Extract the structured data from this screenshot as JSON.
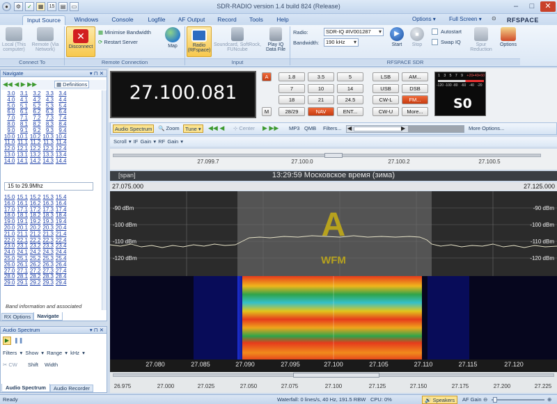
{
  "window": {
    "title": "SDR-RADIO version 1.4 build 824 (Release)",
    "controls": {
      "minimize": "–",
      "maximize": "□",
      "close": "✕"
    },
    "quick_access": [
      "⚙",
      "✓",
      "15"
    ]
  },
  "tabs": [
    "Input Source",
    "Windows",
    "Console",
    "Logfile",
    "AF Output",
    "Record",
    "Tools",
    "Help"
  ],
  "top_right": {
    "options": "Options",
    "full_screen": "Full Screen",
    "logo": "RFSPACE"
  },
  "ribbon": {
    "connect_to": {
      "local": "Local (This computer)",
      "remote": "Remote (Via Network)",
      "label": "Connect To"
    },
    "remote_connection": {
      "disconnect": "Disconnect",
      "minimise": "Minimise Bandwidth",
      "restart": "Restart Server",
      "map": "Map",
      "label": "Remote Connection"
    },
    "input": {
      "radio": "Radio (RFspace)",
      "soundcard": "Soundcard, SoftRock, FUNcube",
      "playiq": "Play IQ Data File",
      "label": "Input"
    },
    "rfspace": {
      "radio_label": "Radio:",
      "radio_value": "SDR-IQ #IV001287",
      "bandwidth_label": "Bandwidth:",
      "bandwidth_value": "190 kHz",
      "start": "Start",
      "stop": "Stop",
      "autostart": "Autostart",
      "swapiq": "Swap IQ",
      "spur": "Spur Reduction",
      "options": "Options",
      "label": "RFSPACE SDR"
    }
  },
  "navigate": {
    "title": "Navigate",
    "definitions": "Definitions",
    "band_label": "15 to 29.9Mhz",
    "footer": "Band information and associated",
    "tabs": [
      "RX Options",
      "Navigate"
    ],
    "grid1": [
      [
        "3.0",
        "3.1",
        "3.2",
        "3.3",
        "3.4"
      ],
      [
        "4.0",
        "4.1",
        "4.2",
        "4.3",
        "4.4"
      ],
      [
        "5.0",
        "5.1",
        "5.2",
        "5.3",
        "5.4"
      ],
      [
        "6.0",
        "6.1",
        "6.2",
        "6.3",
        "6.4"
      ],
      [
        "7.0",
        "7.1",
        "7.2",
        "7.3",
        "7.4"
      ],
      [
        "8.0",
        "8.1",
        "8.2",
        "8.3",
        "8.4"
      ],
      [
        "9.0",
        "9.1",
        "9.2",
        "9.3",
        "9.4"
      ],
      [
        "10.0",
        "10.1",
        "10.2",
        "10.3",
        "10.4"
      ],
      [
        "11.0",
        "11.1",
        "11.2",
        "11.3",
        "11.4"
      ],
      [
        "12.0",
        "12.1",
        "12.2",
        "12.3",
        "12.4"
      ],
      [
        "13.0",
        "13.1",
        "13.2",
        "13.3",
        "13.4"
      ],
      [
        "14.0",
        "14.1",
        "14.2",
        "14.3",
        "14.4"
      ]
    ],
    "grid2": [
      [
        "15.0",
        "15.1",
        "15.2",
        "15.3",
        "15.4"
      ],
      [
        "16.0",
        "16.1",
        "16.2",
        "16.3",
        "16.4"
      ],
      [
        "17.0",
        "17.1",
        "17.2",
        "17.3",
        "17.4"
      ],
      [
        "18.0",
        "18.1",
        "18.2",
        "18.3",
        "18.4"
      ],
      [
        "19.0",
        "19.1",
        "19.2",
        "19.3",
        "19.4"
      ],
      [
        "20.0",
        "20.1",
        "20.2",
        "20.3",
        "20.4"
      ],
      [
        "21.0",
        "21.1",
        "21.2",
        "21.3",
        "21.4"
      ],
      [
        "22.0",
        "22.1",
        "22.2",
        "22.3",
        "22.4"
      ],
      [
        "23.0",
        "23.1",
        "23.2",
        "23.3",
        "23.4"
      ],
      [
        "24.0",
        "24.1",
        "24.2",
        "24.3",
        "24.4"
      ],
      [
        "25.0",
        "25.1",
        "25.2",
        "25.3",
        "25.4"
      ],
      [
        "26.0",
        "26.1",
        "26.2",
        "26.3",
        "26.4"
      ],
      [
        "27.0",
        "27.1",
        "27.2",
        "27.3",
        "27.4"
      ],
      [
        "28.0",
        "28.1",
        "28.2",
        "28.3",
        "28.4"
      ],
      [
        "29.0",
        "29.1",
        "29.2",
        "29.3",
        "29.4"
      ]
    ]
  },
  "audio_spectrum": {
    "title": "Audio Spectrum",
    "menu": [
      "Filters",
      "Show",
      "Range",
      "kHz"
    ],
    "labels": [
      "CW",
      "Shift",
      "Width"
    ],
    "tabs": [
      "Audio Spectrum",
      "Audio Recorder"
    ]
  },
  "frequency": {
    "value": "27.100.081",
    "a_btn": "A",
    "m_btn": "M"
  },
  "keypad": [
    [
      "1.8",
      "3.5",
      "5"
    ],
    [
      "7",
      "10",
      "14"
    ],
    [
      "18",
      "21",
      "24.5"
    ],
    [
      "28/29",
      "NAV",
      "ENT..."
    ]
  ],
  "modes": [
    [
      "LSB",
      "AM..."
    ],
    [
      "USB",
      "DSB"
    ],
    [
      "CW-L",
      "FM..."
    ],
    [
      "CW-U",
      "More..."
    ]
  ],
  "smeter": {
    "value": "S0",
    "scale_top": [
      "1",
      "3",
      "5",
      "7",
      "9",
      "+20",
      "+40",
      "+60"
    ],
    "scale_bot": [
      "-120",
      "-100",
      "-80",
      "-60",
      "-40",
      "-20"
    ]
  },
  "toolbar": {
    "audio_spectrum": "Audio Spectrum",
    "zoom": "Zoom",
    "tune": "Tune",
    "center": "Center",
    "mp3": "MP3",
    "qmb": "QMB",
    "filters": "Filters...",
    "more_options": "More Options...",
    "scroll": "Scroll",
    "if_gain": "IF Gain",
    "rf_gain": "RF Gain"
  },
  "top_axis": [
    "27.099.7",
    "27.100.0",
    "27.100.2",
    "27.100.5"
  ],
  "span": {
    "label": "[span]",
    "time": "13:29:59 Московское время (зима)",
    "left": "27.075.000",
    "right": "27.125.000"
  },
  "spectrum": {
    "dbm": [
      "-90 dBm",
      "-100 dBm",
      "-110 dBm",
      "-120 dBm"
    ],
    "channel_letter": "A",
    "mode": "WFM"
  },
  "bottom_axis": [
    "27.080",
    "27.085",
    "27.090",
    "27.095",
    "27.100",
    "27.105",
    "27.110",
    "27.115",
    "27.120"
  ],
  "bottom_axis2": [
    "26.975",
    "27.000",
    "27.025",
    "27.050",
    "27.075",
    "27.100",
    "27.125",
    "27.150",
    "27.175",
    "27.200",
    "27.225"
  ],
  "status": {
    "ready": "Ready",
    "waterfall": "Waterfall: 0 lines/s, 40 Hz, 191.5 RBW",
    "cpu": "CPU: 0%",
    "speakers": "Speakers",
    "af_gain": "AF Gain"
  }
}
